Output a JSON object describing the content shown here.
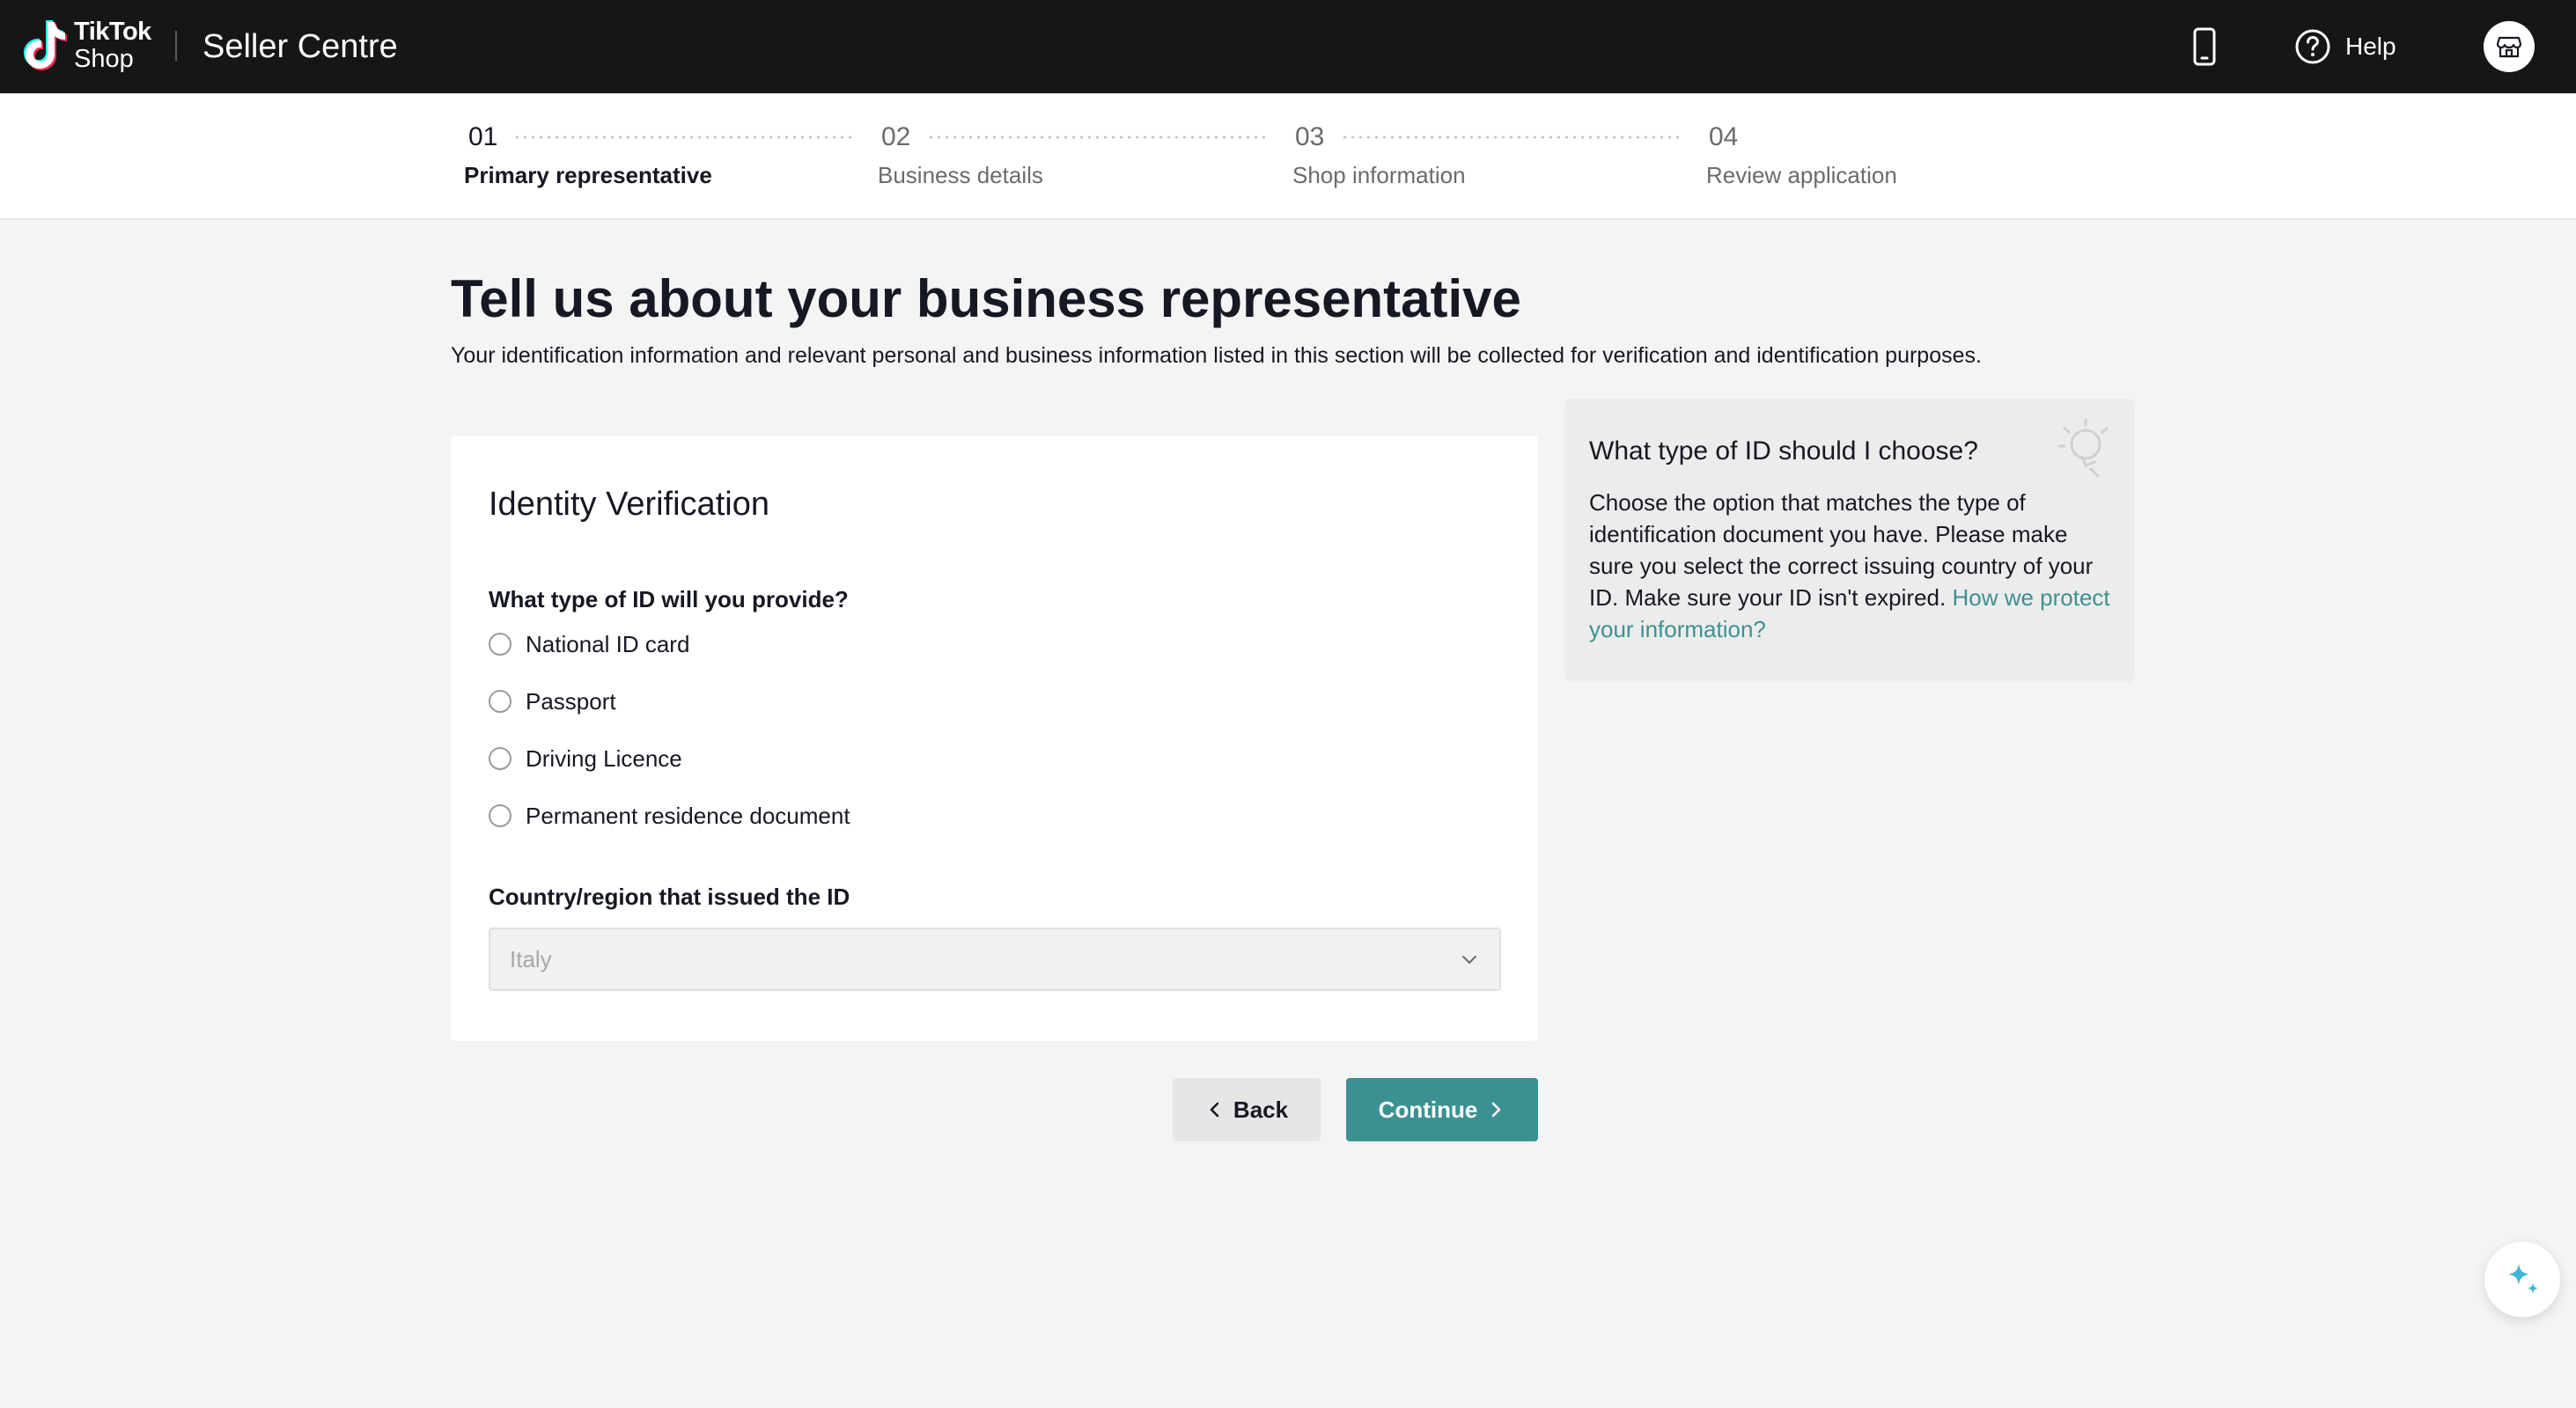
{
  "header": {
    "brand_line1": "TikTok",
    "brand_line2": "Shop",
    "app_title": "Seller Centre",
    "help_label": "Help",
    "icons": {
      "logo": "tiktok-logo-icon",
      "phone": "mobile-phone-icon",
      "help": "question-circle-icon",
      "store": "store-icon"
    }
  },
  "stepper": {
    "steps": [
      {
        "number": "01",
        "label": "Primary representative",
        "active": true
      },
      {
        "number": "02",
        "label": "Business details",
        "active": false
      },
      {
        "number": "03",
        "label": "Shop information",
        "active": false
      },
      {
        "number": "04",
        "label": "Review application",
        "active": false
      }
    ]
  },
  "page": {
    "title": "Tell us about your business representative",
    "description": "Your identification information and relevant personal and business information listed in this section will be collected for verification and identification purposes."
  },
  "identity_card": {
    "title": "Identity Verification",
    "id_question": "What type of ID will you provide?",
    "id_options": [
      "National ID card",
      "Passport",
      "Driving Licence",
      "Permanent residence document"
    ],
    "country_label": "Country/region that issued the ID",
    "country_value": "Italy"
  },
  "actions": {
    "back_label": "Back",
    "continue_label": "Continue"
  },
  "tip": {
    "title": "What type of ID should I choose?",
    "body": "Choose the option that matches the type of identification document you have. Please make sure you select the correct issuing country of your ID. Make sure your ID isn't expired. ",
    "link": "How we protect your information?",
    "icon": "lightbulb-icon"
  },
  "fab": {
    "icon": "sparkle-icon"
  },
  "colors": {
    "topbar": "#161616",
    "accent": "#3b9192",
    "background": "#f4f4f4"
  }
}
